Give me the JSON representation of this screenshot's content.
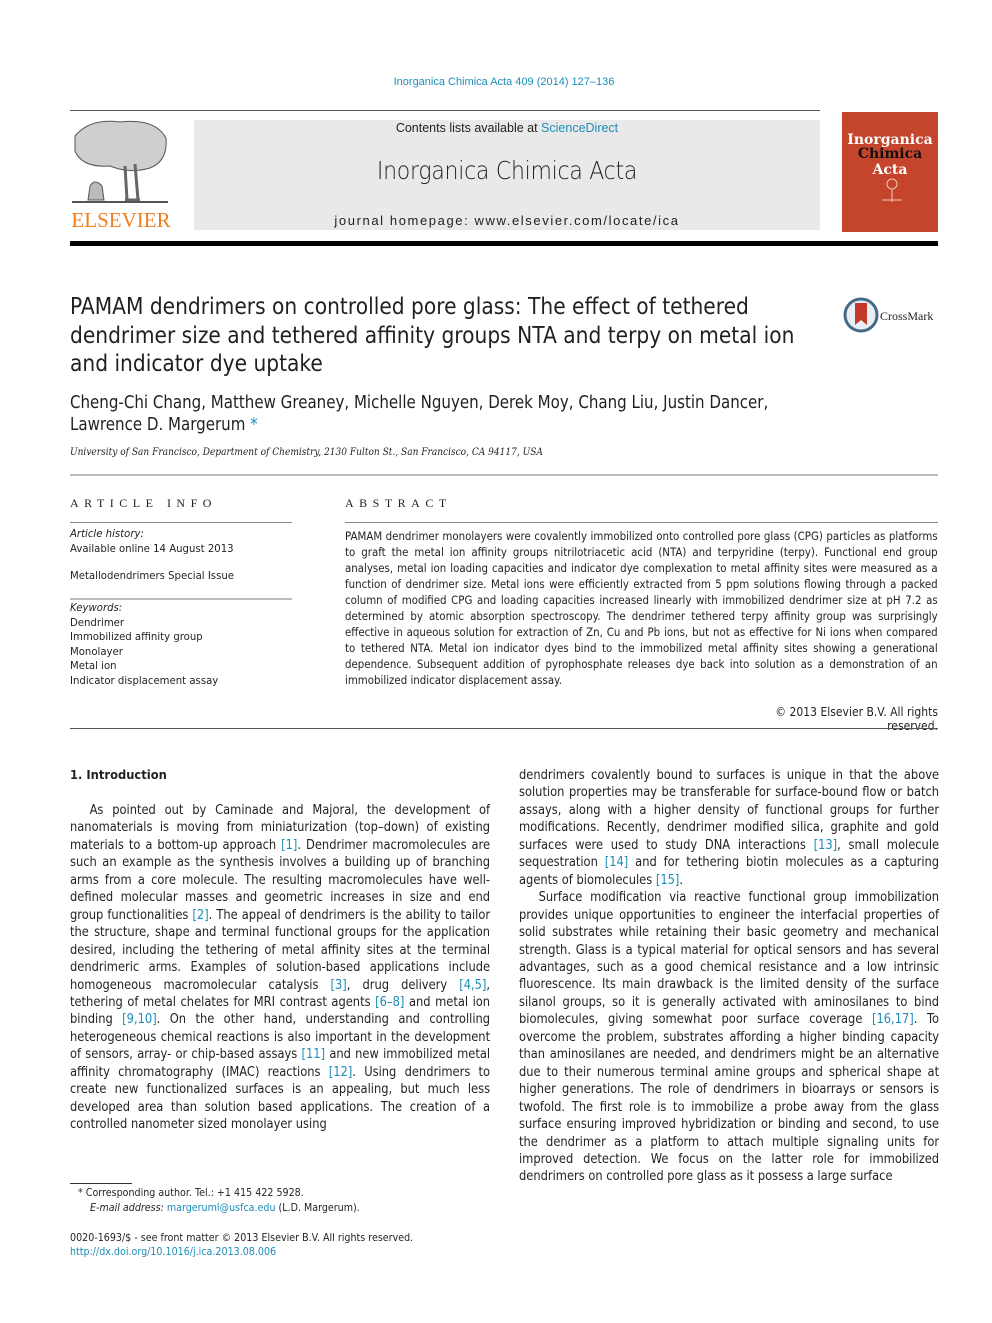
{
  "header": {
    "journal_ref": "Inorganica Chimica Acta 409 (2014) 127–136",
    "contents_prefix": "Contents lists available at ",
    "contents_link": "ScienceDirect",
    "journal_name": "Inorganica Chimica Acta",
    "homepage": "journal homepage: www.elsevier.com/locate/ica",
    "publisher_logo": "ELSEVIER",
    "cover_title_line1": "Inorganica",
    "cover_title_line2a": "Chimica ",
    "cover_title_line2b": "Acta",
    "brand_color": "#f07e1f",
    "link_color": "#1d8db8",
    "cover_color": "#c4452b"
  },
  "article": {
    "title": "PAMAM dendrimers on controlled pore glass: The effect of tethered dendrimer size and tethered affinity groups NTA and terpy on metal ion and indicator dye uptake",
    "crossmark": "CrossMark",
    "authors": "Cheng-Chi Chang, Matthew Greaney, Michelle Nguyen, Derek Moy, Chang Liu, Justin Dancer, Lawrence D. Margerum",
    "corresponding_mark": "*",
    "affiliation": "University of San Francisco, Department of Chemistry, 2130 Fulton St., San Francisco, CA 94117, USA"
  },
  "article_info": {
    "heading": "ARTICLE INFO",
    "history_label": "Article history:",
    "history_value": "Available online 14 August 2013",
    "special_issue": "Metallodendrimers Special Issue",
    "keywords_label": "Keywords:",
    "keywords": [
      "Dendrimer",
      "Immobilized affinity group",
      "Monolayer",
      "Metal ion",
      "Indicator displacement assay"
    ]
  },
  "abstract": {
    "heading": "ABSTRACT",
    "text": "PAMAM dendrimer monolayers were covalently immobilized onto controlled pore glass (CPG) particles as platforms to graft the metal ion affinity groups nitrilotriacetic acid (NTA) and terpyridine (terpy). Functional end group analyses, metal ion loading capacities and indicator dye complexation to metal affinity sites were measured as a function of dendrimer size. Metal ions were efficiently extracted from 5 ppm solutions flowing through a packed column of modified CPG and loading capacities increased linearly with immobilized dendrimer size at pH 7.2 as determined by atomic absorption spectroscopy. The dendrimer tethered terpy affinity group was surprisingly effective in aqueous solution for extraction of Zn, Cu and Pb ions, but not as effective for Ni ions when compared to tethered NTA. Metal ion indicator dyes bind to the immobilized metal affinity sites showing a generational dependence. Subsequent addition of pyrophosphate releases dye back into solution as a demonstration of an immobilized indicator displacement assay.",
    "copyright": "© 2013 Elsevier B.V. All rights reserved."
  },
  "body": {
    "section_heading": "1. Introduction",
    "col1": [
      {
        "t": "As pointed out by Caminade and Majoral, the development of nanomaterials is moving from miniaturization (top–down) of existing materials to a bottom-up approach "
      },
      {
        "c": "[1]"
      },
      {
        "t": ". Dendrimer macromolecules are such an example as the synthesis involves a building up of branching arms from a core molecule. The resulting macromolecules have well-defined molecular masses and geometric increases in size and end group functionalities "
      },
      {
        "c": "[2]"
      },
      {
        "t": ". The appeal of dendrimers is the ability to tailor the structure, shape and terminal functional groups for the application desired, including the tethering of metal affinity sites at the terminal dendrimeric arms. Examples of solution-based applications include homogeneous macromolecular catalysis "
      },
      {
        "c": "[3]"
      },
      {
        "t": ", drug delivery "
      },
      {
        "c": "[4,5]"
      },
      {
        "t": ", tethering of metal chelates for MRI contrast agents "
      },
      {
        "c": "[6–8]"
      },
      {
        "t": " and metal ion binding "
      },
      {
        "c": "[9,10]"
      },
      {
        "t": ". On the other hand, understanding and controlling heterogeneous chemical reactions is also important in the development of sensors, array- or chip-based assays "
      },
      {
        "c": "[11]"
      },
      {
        "t": " and new immobilized metal affinity chromatography (IMAC) reactions "
      },
      {
        "c": "[12]"
      },
      {
        "t": ". Using dendrimers to create new functionalized surfaces is an appealing, but much less developed area than solution based applications. The creation of a controlled nanometer sized monolayer using"
      }
    ],
    "col2_p1": [
      {
        "t": "dendrimers covalently bound to surfaces is unique in that the above solution properties may be transferable for surface-bound flow or batch assays, along with a higher density of functional groups for further modifications. Recently, dendrimer modified silica, graphite and gold surfaces were used to study DNA interactions "
      },
      {
        "c": "[13]"
      },
      {
        "t": ", small molecule sequestration "
      },
      {
        "c": "[14]"
      },
      {
        "t": " and for tethering biotin molecules as a capturing agents of biomolecules "
      },
      {
        "c": "[15]"
      },
      {
        "t": "."
      }
    ],
    "col2_p2": [
      {
        "t": "Surface modification via reactive functional group immobilization provides unique opportunities to engineer the interfacial properties of solid substrates while retaining their basic geometry and mechanical strength. Glass is a typical material for optical sensors and has several advantages, such as a good chemical resistance and a low intrinsic fluorescence. Its main drawback is the limited density of the surface silanol groups, so it is generally activated with aminosilanes to bind biomolecules, giving somewhat poor surface coverage "
      },
      {
        "c": "[16,17]"
      },
      {
        "t": ". To overcome the problem, substrates affording a higher binding capacity than aminosilanes are needed, and dendrimers might be an alternative due to their numerous terminal amine groups and spherical shape at higher generations. The role of dendrimers in bioarrays or sensors is twofold. The first role is to immobilize a probe away from the glass surface ensuring improved hybridization or binding and second, to use the dendrimer as a platform to attach multiple signaling units for improved detection. We focus on the latter role for immobilized dendrimers on controlled pore glass as it possess a large surface"
      }
    ]
  },
  "footer": {
    "corresponding": "* Corresponding author. Tel.: +1 415 422 5928.",
    "email_label": "E-mail address: ",
    "email": "margeruml@usfca.edu",
    "email_suffix": " (L.D. Margerum).",
    "front_matter": "0020-1693/$ - see front matter © 2013 Elsevier B.V. All rights reserved.",
    "doi": "http://dx.doi.org/10.1016/j.ica.2013.08.006"
  }
}
